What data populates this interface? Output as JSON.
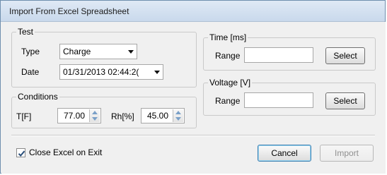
{
  "dialog": {
    "title": "Import From Excel Spreadsheet"
  },
  "test": {
    "legend": "Test",
    "type_label": "Type",
    "type_value": "Charge",
    "date_label": "Date",
    "date_value": "01/31/2013 02:44:2("
  },
  "conditions": {
    "legend": "Conditions",
    "t_label": "T[F]",
    "t_value": "77.00",
    "rh_label": "Rh[%]",
    "rh_value": "45.00"
  },
  "time": {
    "legend": "Time [ms]",
    "range_label": "Range",
    "range_value": "",
    "select_label": "Select"
  },
  "voltage": {
    "legend": "Voltage [V]",
    "range_label": "Range",
    "range_value": "",
    "select_label": "Select"
  },
  "footer": {
    "close_excel_label": "Close Excel on Exit",
    "close_excel_checked": true,
    "cancel_label": "Cancel",
    "import_label": "Import"
  }
}
